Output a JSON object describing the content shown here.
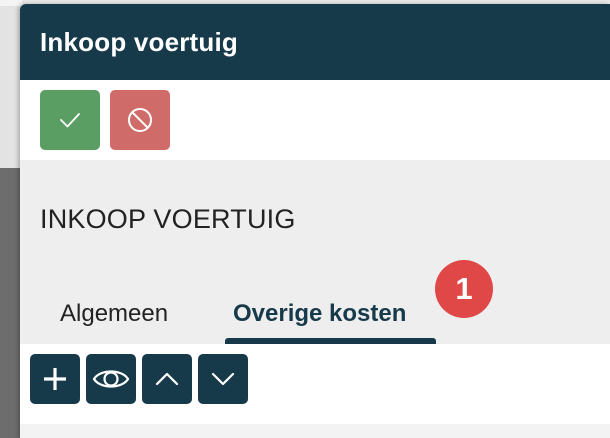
{
  "dialog": {
    "title": "Inkoop voertuig",
    "actions": [
      {
        "name": "confirm",
        "icon": "check-icon",
        "color": "#5a9e63"
      },
      {
        "name": "cancel",
        "icon": "ban-icon",
        "color": "#cf6b68"
      }
    ]
  },
  "section": {
    "heading": "INKOOP VOERTUIG",
    "tabs": [
      {
        "label": "Algemeen",
        "active": false
      },
      {
        "label": "Overige kosten",
        "active": true
      }
    ],
    "badge": "1"
  },
  "toolbar": {
    "buttons": [
      {
        "icon": "plus-icon"
      },
      {
        "icon": "eye-icon"
      },
      {
        "icon": "chevron-up-icon"
      },
      {
        "icon": "chevron-down-icon"
      }
    ]
  },
  "colors": {
    "header": "#173a4b",
    "confirm": "#5a9e63",
    "cancel": "#cf6b68",
    "badge": "#e04848"
  }
}
